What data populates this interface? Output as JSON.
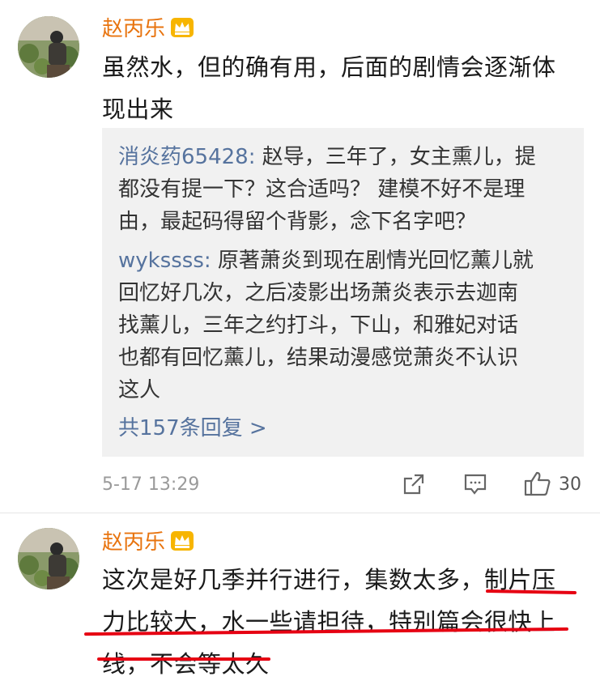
{
  "comments": [
    {
      "author": "赵丙乐",
      "badge_icon": "crown-icon",
      "text_lines": [
        "虽然水，但的确有用，后面的剧情会逐渐体",
        "现出来"
      ],
      "replies": [
        {
          "user": "消炎药65428",
          "sep": ":",
          "lines": [
            " 赵导，三年了，女主熏儿，提",
            "都没有提一下？这合适吗？ 建模不好不是理",
            "由，最起码得留个背影，念下名字吧？"
          ]
        },
        {
          "user": "wykssss",
          "sep": ":",
          "lines": [
            " 原著萧炎到现在剧情光回忆薰儿就",
            "回忆好几次，之后凌影出场萧炎表示去迦南",
            "找薰儿，三年之约打斗，下山，和雅妃对话",
            "也都有回忆薰儿，结果动漫感觉萧炎不认识",
            "这人"
          ]
        }
      ],
      "more_replies": "共157条回复 >",
      "time": "5-17 13:29",
      "like_count": "30"
    },
    {
      "author": "赵丙乐",
      "badge_icon": "crown-icon",
      "text_lines": [
        "这次是好几季并行进行，集数太多，制片压",
        "力比较大，水一些请担待，特别篇会很快上",
        "线，不会等太久"
      ]
    }
  ],
  "colors": {
    "author": "#e8740f",
    "username": "#56739e",
    "reply_bg": "#f1f1f1",
    "underline": "#e60012"
  }
}
